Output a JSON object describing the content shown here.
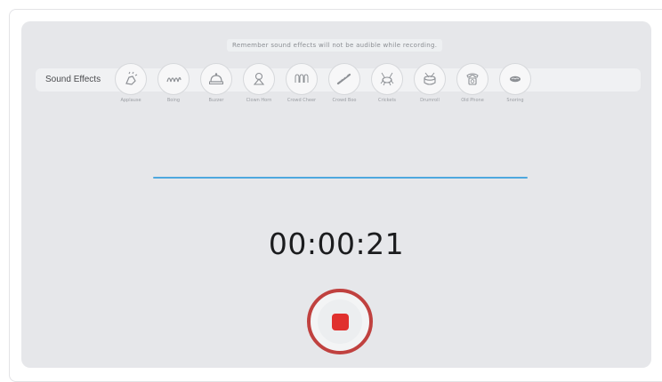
{
  "notice": "Remember sound effects will not be audible while recording.",
  "sound_effects": {
    "label": "Sound Effects",
    "items": [
      {
        "name": "Applause",
        "icon": "applause-icon"
      },
      {
        "name": "Boing",
        "icon": "boing-icon"
      },
      {
        "name": "Buzzer",
        "icon": "buzzer-icon"
      },
      {
        "name": "Clown Horn",
        "icon": "clown-horn-icon"
      },
      {
        "name": "Crowd Cheer",
        "icon": "crowd-cheer-icon"
      },
      {
        "name": "Crowd Boo",
        "icon": "crowd-boo-icon"
      },
      {
        "name": "Crickets",
        "icon": "crickets-icon"
      },
      {
        "name": "Drumroll",
        "icon": "drumroll-icon"
      },
      {
        "name": "Old Phone",
        "icon": "old-phone-icon"
      },
      {
        "name": "Snoring",
        "icon": "snoring-icon"
      }
    ]
  },
  "timer": "00:00:21",
  "colors": {
    "accent_line": "#4ea8de",
    "record_ring": "#c0413f",
    "stop_button": "#e0302e"
  }
}
